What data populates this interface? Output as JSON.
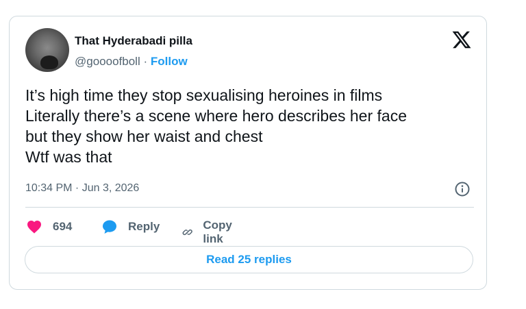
{
  "author": {
    "name": "That Hyderabadi pilla",
    "handle": "@goooofboll",
    "separator": "·",
    "follow_label": "Follow"
  },
  "tweet": {
    "lines": [
      "It’s high time they stop sexualising heroines in films",
      "Literally there’s a scene where hero describes her face",
      "but they show her waist and chest",
      "Wtf was that"
    ],
    "timestamp": "10:34 PM · Jun 3, 2026"
  },
  "actions": {
    "like_count": "694",
    "reply_label": "Reply",
    "copy_label": "Copy link"
  },
  "read_replies_label": "Read 25 replies",
  "icons": {
    "brand": "x-logo-icon",
    "info": "info-icon",
    "like": "heart-icon",
    "reply": "speech-bubble-icon",
    "copy": "link-icon"
  },
  "colors": {
    "accent": "#1d9bf0",
    "like": "#f91880",
    "muted": "#536471",
    "text": "#0f1419",
    "border": "#cfd9de"
  }
}
